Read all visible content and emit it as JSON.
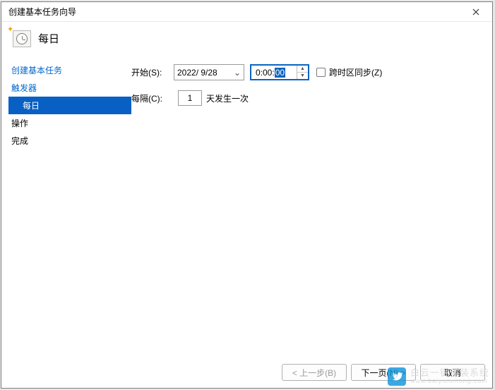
{
  "window": {
    "title": "创建基本任务向导"
  },
  "header": {
    "title": "每日"
  },
  "sidebar": {
    "items": [
      {
        "label": "创建基本任务",
        "link": true
      },
      {
        "label": "触发器",
        "link": true
      },
      {
        "label": "每日",
        "selected": true,
        "sub": true
      },
      {
        "label": "操作",
        "link": false
      },
      {
        "label": "完成",
        "link": false
      }
    ]
  },
  "form": {
    "start_label": "开始(S):",
    "date_value": "2022/ 9/28",
    "time_prefix": "0:00:",
    "time_selected": "00",
    "sync_label": "跨时区同步(Z)",
    "interval_label": "每隔(C):",
    "interval_value": "1",
    "interval_suffix": "天发生一次"
  },
  "buttons": {
    "back": "< 上一步(B)",
    "next": "下一页(N) >",
    "cancel": "取消"
  },
  "watermark": {
    "line1": "白云一键重装系统",
    "line2": "www.baiyunxitong.com"
  }
}
